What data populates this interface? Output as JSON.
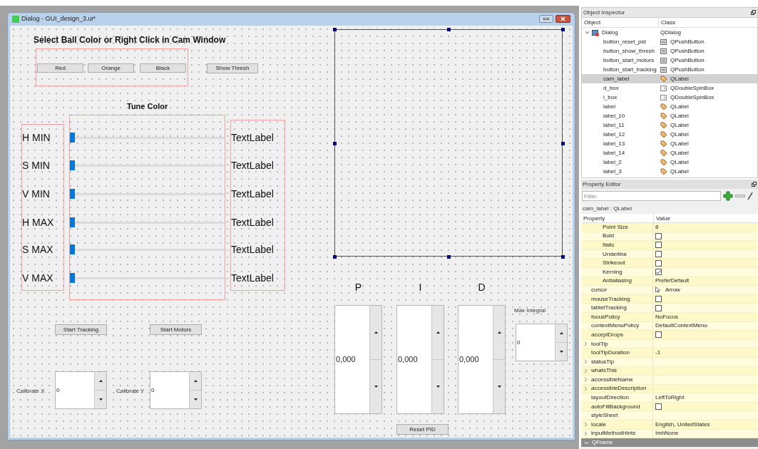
{
  "window": {
    "title": "Dialog - GUI_design_3.ui*"
  },
  "form": {
    "heading": "Select Ball Color or Right Click in Cam Window",
    "color_buttons": [
      "Red",
      "Orange",
      "Black"
    ],
    "show_thresh_button": "Show Thresh",
    "tune_heading": "Tune Color",
    "sliders": [
      {
        "label": "H MIN",
        "level": 0,
        "reading": "TextLabel"
      },
      {
        "label": "S MIN",
        "level": 0,
        "reading": "TextLabel"
      },
      {
        "label": "V MIN",
        "level": 0,
        "reading": "TextLabel"
      },
      {
        "label": "H MAX",
        "level": 0,
        "reading": "TextLabel"
      },
      {
        "label": "S MAX",
        "level": 0,
        "reading": "TextLabel"
      },
      {
        "label": "V MAX",
        "level": 0,
        "reading": "TextLabel"
      }
    ],
    "tracking_button": "Start Tracking",
    "motors_button": "Start Motors",
    "calibrate": [
      {
        "label": "Calibrate X",
        "value": "0"
      },
      {
        "label": "Calibrate Y",
        "value": "0"
      }
    ],
    "pid": [
      {
        "label": "P",
        "value": "0,000"
      },
      {
        "label": "I",
        "value": "0,000"
      },
      {
        "label": "D",
        "value": "0,000"
      }
    ],
    "max_integral": {
      "label": "Max Integral",
      "value": "0"
    },
    "reset_pid_button": "Reset PID"
  },
  "object_inspector": {
    "title": "Object Inspector",
    "columns": [
      "Object",
      "Class"
    ],
    "tree": [
      {
        "name": "Dialog",
        "class": "QDialog",
        "kind": "dialog",
        "expanded": true,
        "selected": false,
        "children": [
          {
            "name": "button_reset_pid",
            "class": "QPushButton",
            "kind": "button",
            "selected": false
          },
          {
            "name": "button_show_thresh",
            "class": "QPushButton",
            "kind": "button",
            "selected": false
          },
          {
            "name": "button_start_motors",
            "class": "QPushButton",
            "kind": "button",
            "selected": false
          },
          {
            "name": "button_start_tracking",
            "class": "QPushButton",
            "kind": "button",
            "selected": false
          },
          {
            "name": "cam_label",
            "class": "QLabel",
            "kind": "label",
            "selected": true
          },
          {
            "name": "d_box",
            "class": "QDoubleSpinBox",
            "kind": "spinbox",
            "selected": false
          },
          {
            "name": "i_box",
            "class": "QDoubleSpinBox",
            "kind": "spinbox",
            "selected": false
          },
          {
            "name": "label",
            "class": "QLabel",
            "kind": "label",
            "selected": false
          },
          {
            "name": "label_10",
            "class": "QLabel",
            "kind": "label",
            "selected": false
          },
          {
            "name": "label_11",
            "class": "QLabel",
            "kind": "label",
            "selected": false
          },
          {
            "name": "label_12",
            "class": "QLabel",
            "kind": "label",
            "selected": false
          },
          {
            "name": "label_13",
            "class": "QLabel",
            "kind": "label",
            "selected": false
          },
          {
            "name": "label_14",
            "class": "QLabel",
            "kind": "label",
            "selected": false
          },
          {
            "name": "label_2",
            "class": "QLabel",
            "kind": "label",
            "selected": false
          },
          {
            "name": "label_3",
            "class": "QLabel",
            "kind": "label",
            "selected": false
          }
        ]
      }
    ]
  },
  "property_editor": {
    "title": "Property Editor",
    "filter": {
      "placeholder": "Filter"
    },
    "subject": "cam_label : QLabel",
    "columns": [
      "Property",
      "Value"
    ],
    "font_subproperties": [
      {
        "property": "Point Size",
        "kind": "text",
        "value": "8"
      },
      {
        "property": "Bold",
        "kind": "checkbox",
        "checked": false
      },
      {
        "property": "Italic",
        "kind": "checkbox",
        "checked": false
      },
      {
        "property": "Underline",
        "kind": "checkbox",
        "checked": false
      },
      {
        "property": "Strikeout",
        "kind": "checkbox",
        "checked": false
      },
      {
        "property": "Kerning",
        "kind": "checkbox",
        "checked": true
      },
      {
        "property": "Antialiasing",
        "kind": "text",
        "value": "PreferDefault"
      }
    ],
    "rows": [
      {
        "property": "cursor",
        "kind": "cursor",
        "value": "Arrow",
        "expandable": false
      },
      {
        "property": "mouseTracking",
        "kind": "checkbox",
        "checked": false,
        "expandable": false
      },
      {
        "property": "tabletTracking",
        "kind": "checkbox",
        "checked": false,
        "expandable": false
      },
      {
        "property": "focusPolicy",
        "kind": "text",
        "value": "NoFocus",
        "expandable": false
      },
      {
        "property": "contextMenuPolicy",
        "kind": "text",
        "value": "DefaultContextMenu",
        "expandable": false
      },
      {
        "property": "acceptDrops",
        "kind": "checkbox",
        "checked": false,
        "expandable": false
      },
      {
        "property": "toolTip",
        "kind": "text",
        "expandable": true
      },
      {
        "property": "toolTipDuration",
        "kind": "text",
        "value": "-1",
        "expandable": false
      },
      {
        "property": "statusTip",
        "kind": "text",
        "expandable": true
      },
      {
        "property": "whatsThis",
        "kind": "text",
        "expandable": true
      },
      {
        "property": "accessibleName",
        "kind": "text",
        "expandable": true
      },
      {
        "property": "accessibleDescription",
        "kind": "text",
        "expandable": true
      },
      {
        "property": "layoutDirection",
        "kind": "text",
        "value": "LeftToRight",
        "expandable": false
      },
      {
        "property": "autoFillBackground",
        "kind": "checkbox",
        "checked": false,
        "expandable": false
      },
      {
        "property": "styleSheet",
        "kind": "text",
        "expandable": false
      },
      {
        "property": "locale",
        "kind": "text",
        "value": "English, UnitedStates",
        "expandable": true
      },
      {
        "property": "inputMethodHints",
        "kind": "text",
        "value": "ImhNone",
        "expandable": true
      }
    ],
    "section": {
      "title": "QFrame",
      "expanded": true
    }
  }
}
